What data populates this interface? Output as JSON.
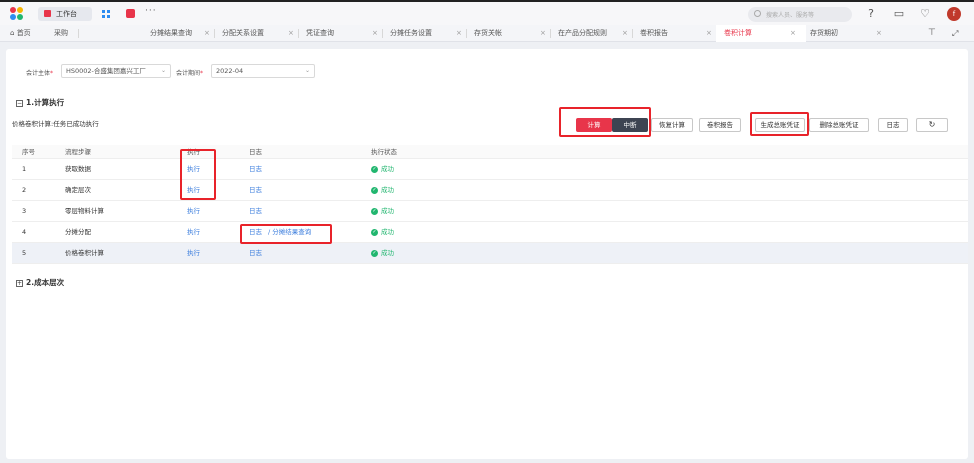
{
  "topbar": {
    "workbench_label": "工作台",
    "more_label": "···",
    "search_placeholder": "搜索人员、服务等",
    "avatar_initial": "f"
  },
  "tabs": [
    {
      "label": "首页",
      "icon": "home-icon"
    },
    {
      "label": "采购"
    },
    {
      "label": "分摊结果查询"
    },
    {
      "label": "分配关系设置"
    },
    {
      "label": "凭证查询"
    },
    {
      "label": "分摊任务设置"
    },
    {
      "label": "存货关帐"
    },
    {
      "label": "在产品分配规则"
    },
    {
      "label": "卷积报告"
    },
    {
      "label": "卷积计算",
      "active": true
    },
    {
      "label": "存货期初"
    }
  ],
  "filters": {
    "entity_label": "会计主体",
    "entity_value": "HS0002-合盛集团嘉兴工厂",
    "period_label": "会计期间",
    "period_value": "2022-04"
  },
  "section1": {
    "title": "1.计算执行",
    "status_message": "价格卷积计算:任务已成功执行"
  },
  "buttons": {
    "calculate": "计算",
    "interrupt": "中断",
    "restore": "恢复计算",
    "report": "卷积报告",
    "gen_voucher": "生成总账凭证",
    "del_voucher": "删除总账凭证",
    "log": "日志"
  },
  "table": {
    "headers": [
      "序号",
      "流程步骤",
      "执行",
      "日志",
      "执行状态"
    ],
    "rows": [
      {
        "no": "1",
        "step": "获取数据",
        "exec": "执行",
        "log": "日志",
        "log_extra": "",
        "status": "成功"
      },
      {
        "no": "2",
        "step": "确定层次",
        "exec": "执行",
        "log": "日志",
        "log_extra": "",
        "status": "成功"
      },
      {
        "no": "3",
        "step": "零层物料计算",
        "exec": "执行",
        "log": "日志",
        "log_extra": "",
        "status": "成功"
      },
      {
        "no": "4",
        "step": "分摊分配",
        "exec": "执行",
        "log": "日志",
        "log_extra": "/ 分摊结果查询",
        "status": "成功"
      },
      {
        "no": "5",
        "step": "价格卷积计算",
        "exec": "执行",
        "log": "日志",
        "log_extra": "",
        "status": "成功"
      }
    ]
  },
  "section2": {
    "title": "2.成本层次"
  },
  "colors": {
    "accent": "#e8354a",
    "link": "#3b7ddd",
    "success": "#21b66f",
    "highlight": "#e8232a"
  }
}
